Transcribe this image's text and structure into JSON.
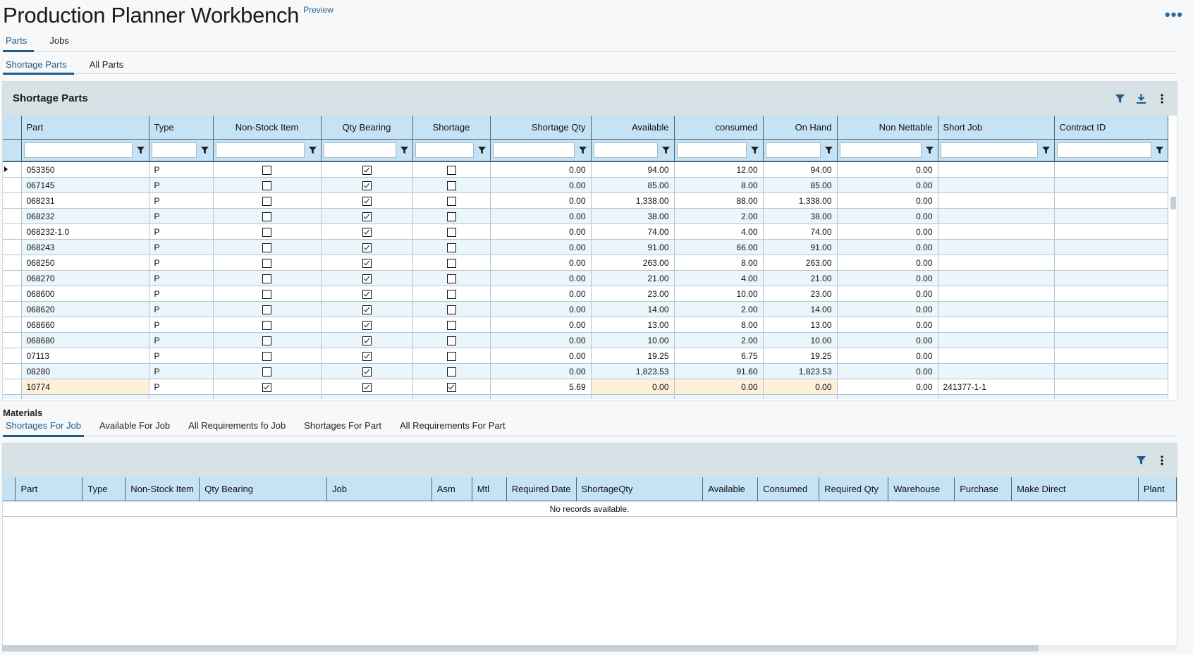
{
  "app": {
    "title": "Production Planner Workbench",
    "badge": "Preview",
    "more": "•••"
  },
  "main_tabs": [
    {
      "label": "Parts",
      "active": true
    },
    {
      "label": "Jobs",
      "active": false
    }
  ],
  "sub_tabs": [
    {
      "label": "Shortage Parts",
      "active": true
    },
    {
      "label": "All Parts",
      "active": false
    }
  ],
  "shortage_panel": {
    "title": "Shortage Parts",
    "icons": [
      "filter-icon",
      "download-icon",
      "kebab-menu-icon"
    ],
    "columns": [
      "Part",
      "Type",
      "Non-Stock Item",
      "Qty Bearing",
      "Shortage",
      "Shortage Qty",
      "Available",
      "consumed",
      "On Hand",
      "Non Nettable",
      "Short Job",
      "Contract ID"
    ],
    "rows": [
      {
        "part": "053350",
        "type": "P",
        "non_stock": false,
        "qty_bearing": true,
        "shortage": false,
        "shortage_qty": "0.00",
        "available": "94.00",
        "consumed": "12.00",
        "on_hand": "94.00",
        "non_nettable": "0.00",
        "short_job": "",
        "contract_id": "",
        "selected": true
      },
      {
        "part": "067145",
        "type": "P",
        "non_stock": false,
        "qty_bearing": true,
        "shortage": false,
        "shortage_qty": "0.00",
        "available": "85.00",
        "consumed": "8.00",
        "on_hand": "85.00",
        "non_nettable": "0.00",
        "short_job": "",
        "contract_id": ""
      },
      {
        "part": "068231",
        "type": "P",
        "non_stock": false,
        "qty_bearing": true,
        "shortage": false,
        "shortage_qty": "0.00",
        "available": "1,338.00",
        "consumed": "88.00",
        "on_hand": "1,338.00",
        "non_nettable": "0.00",
        "short_job": "",
        "contract_id": ""
      },
      {
        "part": "068232",
        "type": "P",
        "non_stock": false,
        "qty_bearing": true,
        "shortage": false,
        "shortage_qty": "0.00",
        "available": "38.00",
        "consumed": "2.00",
        "on_hand": "38.00",
        "non_nettable": "0.00",
        "short_job": "",
        "contract_id": ""
      },
      {
        "part": "068232-1.0",
        "type": "P",
        "non_stock": false,
        "qty_bearing": true,
        "shortage": false,
        "shortage_qty": "0.00",
        "available": "74.00",
        "consumed": "4.00",
        "on_hand": "74.00",
        "non_nettable": "0.00",
        "short_job": "",
        "contract_id": ""
      },
      {
        "part": "068243",
        "type": "P",
        "non_stock": false,
        "qty_bearing": true,
        "shortage": false,
        "shortage_qty": "0.00",
        "available": "91.00",
        "consumed": "66.00",
        "on_hand": "91.00",
        "non_nettable": "0.00",
        "short_job": "",
        "contract_id": ""
      },
      {
        "part": "068250",
        "type": "P",
        "non_stock": false,
        "qty_bearing": true,
        "shortage": false,
        "shortage_qty": "0.00",
        "available": "263.00",
        "consumed": "8.00",
        "on_hand": "263.00",
        "non_nettable": "0.00",
        "short_job": "",
        "contract_id": ""
      },
      {
        "part": "068270",
        "type": "P",
        "non_stock": false,
        "qty_bearing": true,
        "shortage": false,
        "shortage_qty": "0.00",
        "available": "21.00",
        "consumed": "4.00",
        "on_hand": "21.00",
        "non_nettable": "0.00",
        "short_job": "",
        "contract_id": ""
      },
      {
        "part": "068600",
        "type": "P",
        "non_stock": false,
        "qty_bearing": true,
        "shortage": false,
        "shortage_qty": "0.00",
        "available": "23.00",
        "consumed": "10.00",
        "on_hand": "23.00",
        "non_nettable": "0.00",
        "short_job": "",
        "contract_id": ""
      },
      {
        "part": "068620",
        "type": "P",
        "non_stock": false,
        "qty_bearing": true,
        "shortage": false,
        "shortage_qty": "0.00",
        "available": "14.00",
        "consumed": "2.00",
        "on_hand": "14.00",
        "non_nettable": "0.00",
        "short_job": "",
        "contract_id": ""
      },
      {
        "part": "068660",
        "type": "P",
        "non_stock": false,
        "qty_bearing": true,
        "shortage": false,
        "shortage_qty": "0.00",
        "available": "13.00",
        "consumed": "8.00",
        "on_hand": "13.00",
        "non_nettable": "0.00",
        "short_job": "",
        "contract_id": ""
      },
      {
        "part": "068680",
        "type": "P",
        "non_stock": false,
        "qty_bearing": true,
        "shortage": false,
        "shortage_qty": "0.00",
        "available": "10.00",
        "consumed": "2.00",
        "on_hand": "10.00",
        "non_nettable": "0.00",
        "short_job": "",
        "contract_id": ""
      },
      {
        "part": "07113",
        "type": "P",
        "non_stock": false,
        "qty_bearing": true,
        "shortage": false,
        "shortage_qty": "0.00",
        "available": "19.25",
        "consumed": "6.75",
        "on_hand": "19.25",
        "non_nettable": "0.00",
        "short_job": "",
        "contract_id": ""
      },
      {
        "part": "08280",
        "type": "P",
        "non_stock": false,
        "qty_bearing": true,
        "shortage": false,
        "shortage_qty": "0.00",
        "available": "1,823.53",
        "consumed": "91.60",
        "on_hand": "1,823.53",
        "non_nettable": "0.00",
        "short_job": "",
        "contract_id": ""
      },
      {
        "part": "10774",
        "type": "P",
        "non_stock": true,
        "qty_bearing": true,
        "shortage": true,
        "shortage_qty": "5.69",
        "available": "0.00",
        "consumed": "0.00",
        "on_hand": "0.00",
        "non_nettable": "0.00",
        "short_job": "241377-1-1",
        "contract_id": "",
        "highlight": true
      }
    ]
  },
  "materials": {
    "heading": "Materials",
    "tabs": [
      {
        "label": "Shortages For Job",
        "active": true
      },
      {
        "label": "Available For Job",
        "active": false
      },
      {
        "label": "All Requirements fo Job",
        "active": false
      },
      {
        "label": "Shortages For Part",
        "active": false
      },
      {
        "label": "All Requirements For Part",
        "active": false
      }
    ],
    "icons": [
      "filter-icon",
      "kebab-menu-icon"
    ],
    "columns": [
      "Part",
      "Type",
      "Non-Stock Item",
      "Qty Bearing",
      "Job",
      "Asm",
      "Mtl",
      "Required Date",
      "ShortageQty",
      "Available",
      "Consumed",
      "Required Qty",
      "Warehouse",
      "Purchase",
      "Make Direct",
      "Plant"
    ],
    "empty_text": "No records available."
  },
  "colors": {
    "header_bg": "#c6e3f6",
    "panel_header_bg": "#d7e2e7",
    "accent": "#1f5a8a",
    "row_alt": "#eaf5fc",
    "highlight_row": "#fdf0d8"
  }
}
